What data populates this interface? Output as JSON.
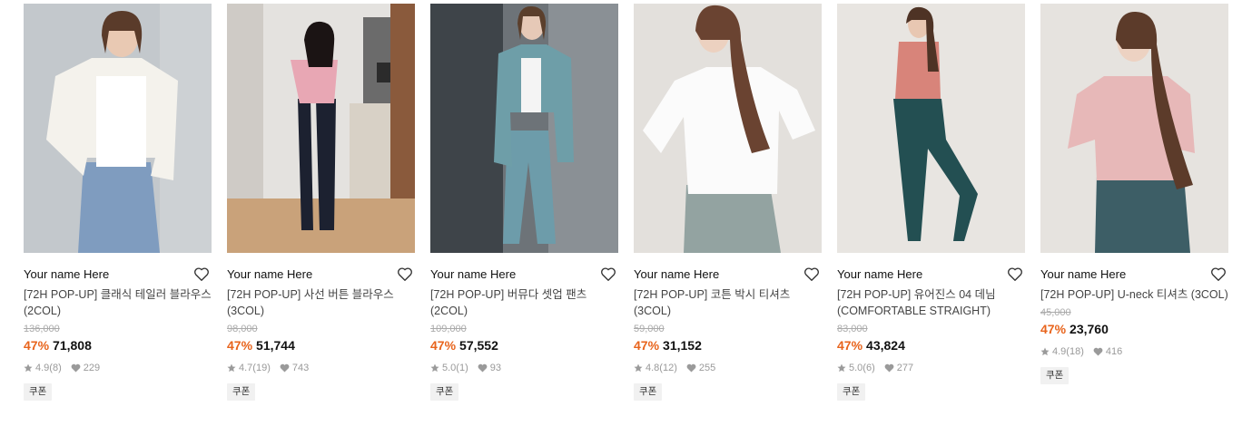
{
  "colors": {
    "discount": "#e8641c",
    "text": "#111111",
    "muted": "#999999"
  },
  "products": [
    {
      "brand": "Your name Here",
      "name": "[72H POP-UP] 클래식 테일러 블라우스 (2COL)",
      "original_price": "136,000",
      "discount": "47%",
      "sale_price": "71,808",
      "rating": "4.9",
      "reviews": "(8)",
      "likes": "229",
      "coupon": "쿠폰",
      "heart_icon": "heart-outline-icon"
    },
    {
      "brand": "Your name Here",
      "name": "[72H POP-UP] 사선 버튼 블라우스 (3COL)",
      "original_price": "98,000",
      "discount": "47%",
      "sale_price": "51,744",
      "rating": "4.7",
      "reviews": "(19)",
      "likes": "743",
      "coupon": "쿠폰",
      "heart_icon": "heart-outline-icon"
    },
    {
      "brand": "Your name Here",
      "name": "[72H POP-UP] 버뮤다 셋업 팬츠 (2COL)",
      "original_price": "109,000",
      "discount": "47%",
      "sale_price": "57,552",
      "rating": "5.0",
      "reviews": "(1)",
      "likes": "93",
      "coupon": "쿠폰",
      "heart_icon": "heart-outline-icon"
    },
    {
      "brand": "Your name Here",
      "name": "[72H POP-UP] 코튼 박시 티셔츠 (3COL)",
      "original_price": "59,000",
      "discount": "47%",
      "sale_price": "31,152",
      "rating": "4.8",
      "reviews": "(12)",
      "likes": "255",
      "coupon": "쿠폰",
      "heart_icon": "heart-outline-icon"
    },
    {
      "brand": "Your name Here",
      "name": "[72H POP-UP] 유어진스 04 데님 (COMFORTABLE STRAIGHT)",
      "original_price": "83,000",
      "discount": "47%",
      "sale_price": "43,824",
      "rating": "5.0",
      "reviews": "(6)",
      "likes": "277",
      "coupon": "쿠폰",
      "heart_icon": "heart-outline-icon"
    },
    {
      "brand": "Your name Here",
      "name": "[72H POP-UP] U-neck 티셔츠 (3COL)",
      "original_price": "45,000",
      "discount": "47%",
      "sale_price": "23,760",
      "rating": "4.9",
      "reviews": "(18)",
      "likes": "416",
      "coupon": "쿠폰",
      "heart_icon": "heart-outline-icon"
    }
  ]
}
